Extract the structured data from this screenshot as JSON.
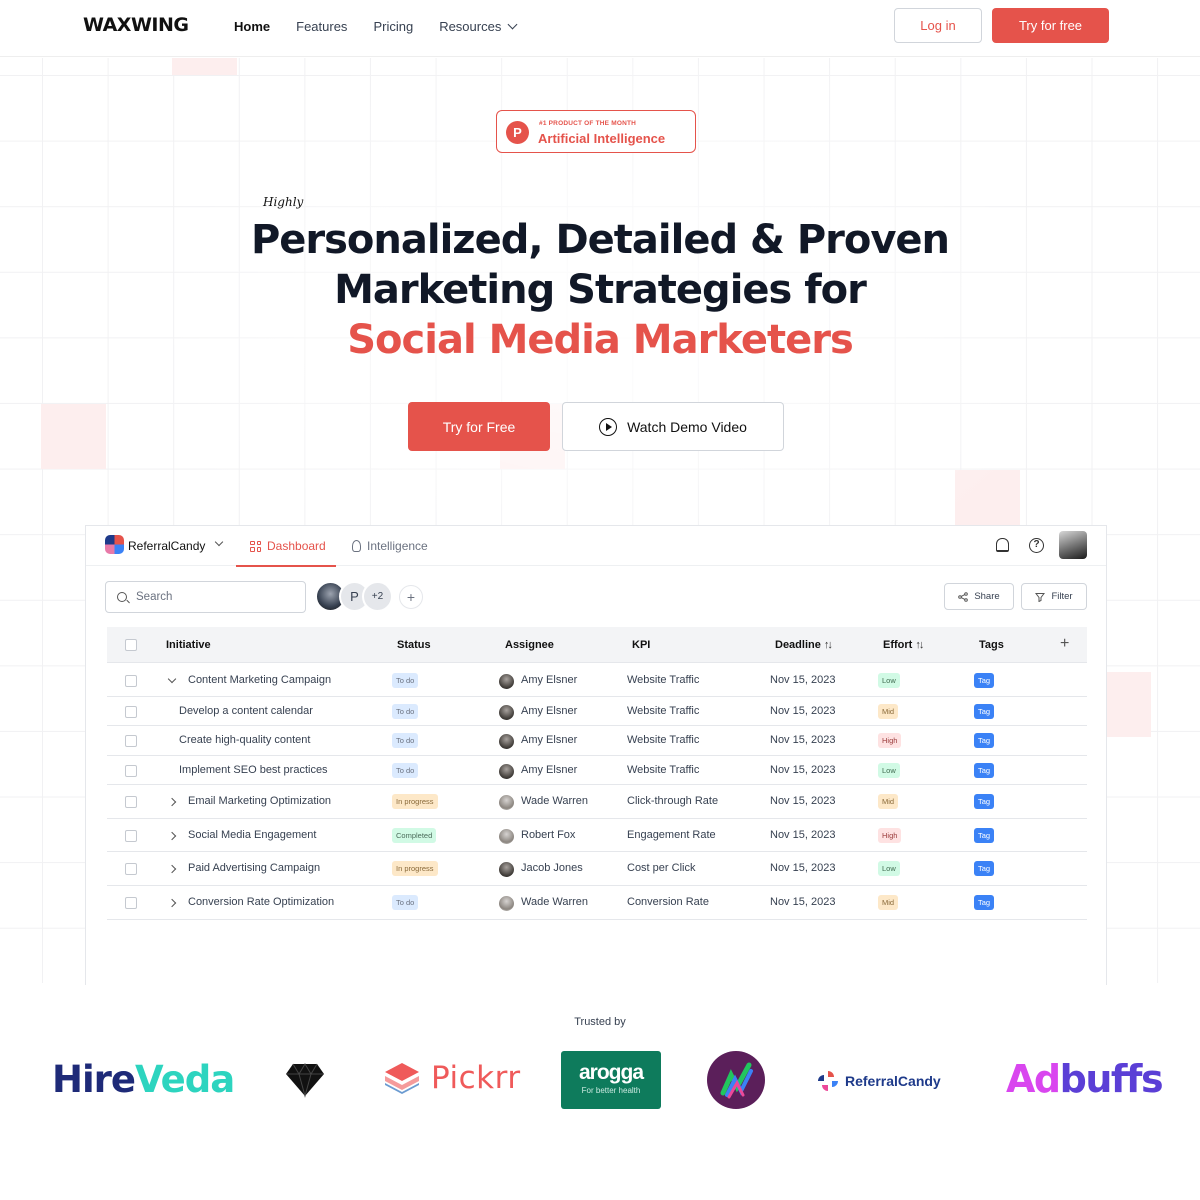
{
  "nav": {
    "logo": "WAXWING",
    "links": [
      "Home",
      "Features",
      "Pricing",
      "Resources"
    ],
    "login": "Log in",
    "try": "Try for free"
  },
  "hero": {
    "badge_small": "#1 PRODUCT OF THE MONTH",
    "badge_big": "Artificial Intelligence",
    "badge_letter": "P",
    "highly": "Highly",
    "line1": "Personalized, Detailed & Proven",
    "line2": "Marketing Strategies for",
    "line3": "Social Media Marketers",
    "cta_primary": "Try for Free",
    "cta_secondary": "Watch Demo Video"
  },
  "app": {
    "workspace": "ReferralCandy",
    "tabs": [
      "Dashboard",
      "Intelligence"
    ],
    "search_placeholder": "Search",
    "avatar_letter": "P",
    "avatar_more": "+2",
    "add": "+",
    "share": "Share",
    "filter": "Filter",
    "columns": [
      "Initiative",
      "Status",
      "Assignee",
      "KPI",
      "Deadline",
      "Effort",
      "Tags"
    ],
    "sort_glyph": "↑↓",
    "rows": [
      {
        "initiative": "Content Marketing Campaign",
        "status": "To do",
        "assignee": "Amy Elsner",
        "kpi": "Website Traffic",
        "deadline": "Nov 15, 2023",
        "effort": "Low",
        "tag": "Tag"
      },
      {
        "initiative": "Develop a content calendar",
        "status": "To do",
        "assignee": "Amy Elsner",
        "kpi": "Website Traffic",
        "deadline": "Nov 15, 2023",
        "effort": "Mid",
        "tag": "Tag"
      },
      {
        "initiative": "Create high-quality content",
        "status": "To do",
        "assignee": "Amy Elsner",
        "kpi": "Website Traffic",
        "deadline": "Nov 15, 2023",
        "effort": "High",
        "tag": "Tag"
      },
      {
        "initiative": "Implement SEO best practices",
        "status": "To do",
        "assignee": "Amy Elsner",
        "kpi": "Website Traffic",
        "deadline": "Nov 15, 2023",
        "effort": "Low",
        "tag": "Tag"
      },
      {
        "initiative": "Email Marketing Optimization",
        "status": "In progress",
        "assignee": "Wade Warren",
        "kpi": "Click-through Rate",
        "deadline": "Nov 15, 2023",
        "effort": "Mid",
        "tag": "Tag"
      },
      {
        "initiative": "Social Media Engagement",
        "status": "Completed",
        "assignee": "Robert Fox",
        "kpi": "Engagement Rate",
        "deadline": "Nov 15, 2023",
        "effort": "High",
        "tag": "Tag"
      },
      {
        "initiative": "Paid Advertising Campaign",
        "status": "In progress",
        "assignee": "Jacob Jones",
        "kpi": "Cost per Click",
        "deadline": "Nov 15, 2023",
        "effort": "Low",
        "tag": "Tag"
      },
      {
        "initiative": "Conversion Rate Optimization",
        "status": "To do",
        "assignee": "Wade Warren",
        "kpi": "Conversion Rate",
        "deadline": "Nov 15, 2023",
        "effort": "Mid",
        "tag": "Tag"
      }
    ]
  },
  "trusted": {
    "label": "Trusted by",
    "hireveda_a": "Hire",
    "hireveda_b": "Veda",
    "pickrr": "Pickrr",
    "arogga": "arogga",
    "arogga_sub": "For better health",
    "referralcandy": "ReferralCandy",
    "adbuffs_a": "Ad",
    "adbuffs_b": "buffs"
  },
  "colors": {
    "accent": "#e5534b",
    "tag": "#3b82f6",
    "heading": "#111827"
  }
}
